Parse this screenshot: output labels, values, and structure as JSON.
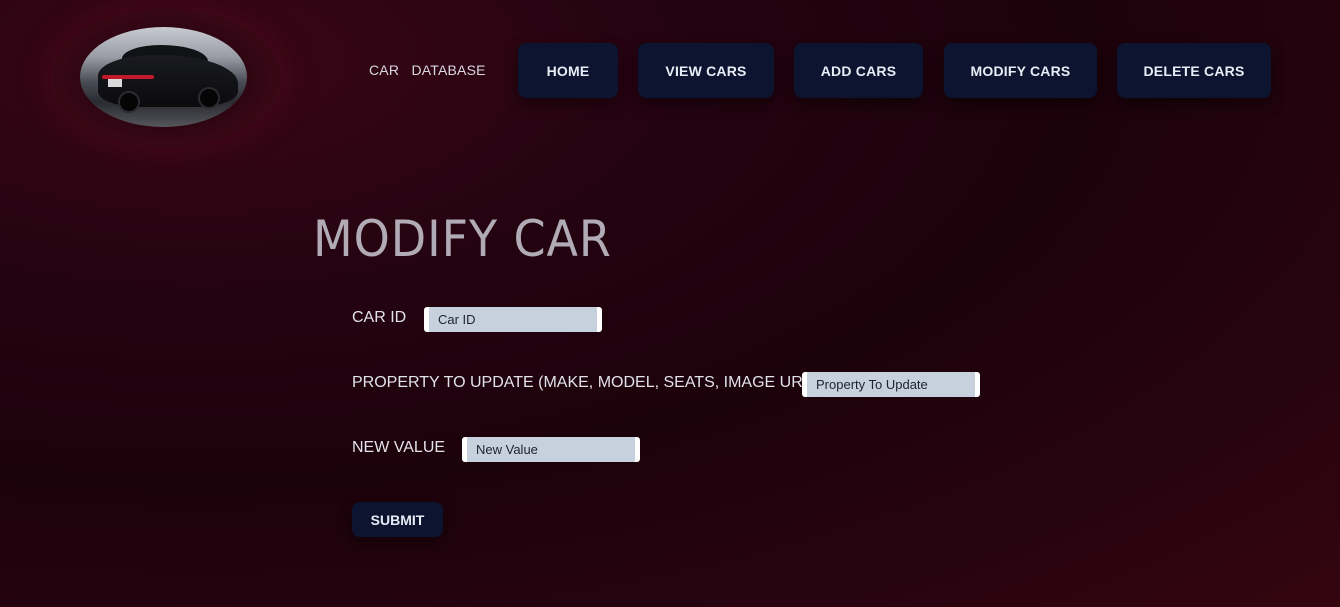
{
  "header": {
    "brand_left": "CAR",
    "brand_right": "DATABASE",
    "nav": [
      {
        "label": "HOME"
      },
      {
        "label": "VIEW CARS"
      },
      {
        "label": "ADD CARS"
      },
      {
        "label": "MODIFY CARS"
      },
      {
        "label": "DELETE CARS"
      }
    ]
  },
  "main": {
    "title": "MODIFY CAR",
    "fields": [
      {
        "label": "CAR ID",
        "placeholder": "Car ID",
        "value": ""
      },
      {
        "label": "PROPERTY TO UPDATE (MAKE, MODEL, SEATS, IMAGE URL",
        "placeholder": "Property To Update",
        "value": ""
      },
      {
        "label": "NEW VALUE",
        "placeholder": "New Value",
        "value": ""
      }
    ],
    "submit_label": "SUBMIT"
  },
  "colors": {
    "background": "#1c020b",
    "accent_button": "#0c1430",
    "input_bg": "#c7d1de"
  },
  "icons": {
    "logo": "car-photo-logo"
  }
}
